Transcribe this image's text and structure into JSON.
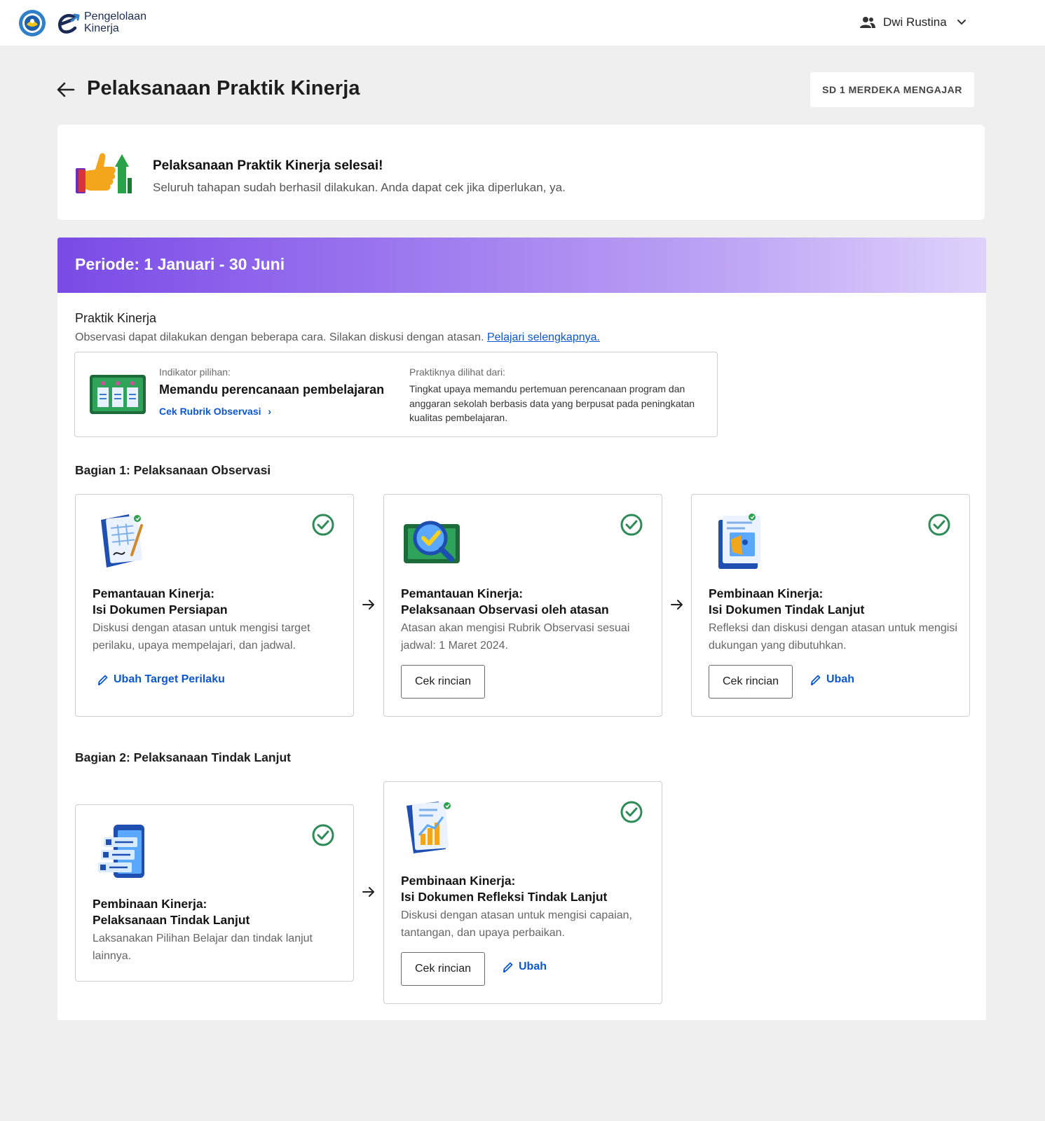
{
  "header": {
    "app_name_line1": "Pengelolaan",
    "app_name_line2": "Kinerja",
    "user_name": "Dwi Rustina"
  },
  "page": {
    "title": "Pelaksanaan Praktik Kinerja",
    "school": "SD 1 MERDEKA MENGAJAR"
  },
  "completion": {
    "title": "Pelaksanaan Praktik Kinerja selesai!",
    "subtitle": "Seluruh tahapan sudah berhasil dilakukan. Anda dapat cek jika diperlukan, ya."
  },
  "period": {
    "title": "Periode: 1 Januari - 30 Juni",
    "colors": [
      "#7a4be6",
      "#ded2fb"
    ]
  },
  "praktik": {
    "title": "Praktik Kinerja",
    "subtitle": "Observasi dapat dilakukan dengan beberapa cara. Silakan diskusi dengan atasan.",
    "learn_more": "Pelajari selengkapnya.",
    "indicator_label": "Indikator pilihan:",
    "indicator_name": "Memandu perencanaan pembelajaran",
    "rubric_link": "Cek Rubrik Observasi",
    "seen_from_label": "Praktiknya dilihat dari:",
    "seen_from_text": "Tingkat upaya memandu pertemuan perencanaan program dan anggaran sekolah berbasis data yang berpusat pada peningkatan kualitas pembelajaran."
  },
  "section1": {
    "title": "Bagian 1: Pelaksanaan Observasi",
    "steps": [
      {
        "title_line1": "Pemantauan Kinerja:",
        "title_line2": "Isi Dokumen Persiapan",
        "desc": "Diskusi dengan atasan untuk mengisi target perilaku, upaya mempelajari, dan jadwal.",
        "link": "Ubah Target Perilaku",
        "status": "complete",
        "icon": "document-edit-icon"
      },
      {
        "title_line1": "Pemantauan Kinerja:",
        "title_line2": "Pelaksanaan Observasi oleh atasan",
        "desc": "Atasan akan mengisi Rubrik Observasi sesuai jadwal: 1 Maret 2024.",
        "button": "Cek rincian",
        "status": "complete",
        "icon": "magnifier-check-icon"
      },
      {
        "title_line1": "Pembinaan Kinerja:",
        "title_line2": "Isi Dokumen Tindak Lanjut",
        "desc": "Refleksi dan diskusi dengan atasan untuk mengisi dukungan yang dibutuhkan.",
        "button": "Cek rincian",
        "link": "Ubah",
        "status": "complete",
        "icon": "document-profile-icon"
      }
    ]
  },
  "section2": {
    "title": "Bagian 2: Pelaksanaan Tindak Lanjut",
    "steps": [
      {
        "title_line1": "Pembinaan Kinerja:",
        "title_line2": "Pelaksanaan Tindak Lanjut",
        "desc": "Laksanakan Pilihan Belajar dan tindak lanjut lainnya.",
        "status": "complete",
        "icon": "checklist-phone-icon"
      },
      {
        "title_line1": "Pembinaan Kinerja:",
        "title_line2": "Isi Dokumen Refleksi Tindak Lanjut",
        "desc": "Diskusi dengan atasan untuk mengisi capaian, tantangan, dan upaya perbaikan.",
        "button": "Cek rincian",
        "link": "Ubah",
        "status": "complete",
        "icon": "chart-report-icon"
      }
    ]
  },
  "colors": {
    "link": "#0b57d0",
    "check": "#2e8b57",
    "purple": "#7a4be6"
  }
}
